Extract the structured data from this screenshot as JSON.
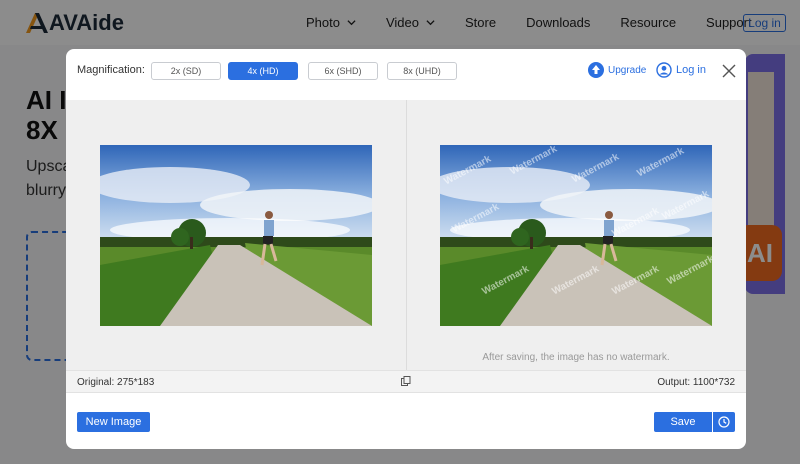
{
  "brand": {
    "name": "AVAide"
  },
  "nav": {
    "items": [
      {
        "label": "Photo",
        "dropdown": true
      },
      {
        "label": "Video",
        "dropdown": true
      },
      {
        "label": "Store",
        "dropdown": false
      },
      {
        "label": "Downloads",
        "dropdown": false
      },
      {
        "label": "Resource",
        "dropdown": false
      },
      {
        "label": "Support",
        "dropdown": false
      }
    ],
    "login_label": "Log in"
  },
  "background": {
    "title_line1": "AI I",
    "title_line2": "8X",
    "subtitle_line1": "Upsca",
    "subtitle_line2": "blurry",
    "badge_text": "AI"
  },
  "modal": {
    "magnification_label": "Magnification:",
    "magnification_options": [
      {
        "label": "2x (SD)",
        "active": false
      },
      {
        "label": "4x (HD)",
        "active": true
      },
      {
        "label": "6x (SHD)",
        "active": false
      },
      {
        "label": "8x (UHD)",
        "active": false
      }
    ],
    "upgrade_label": "Upgrade",
    "login_label": "Log in",
    "watermark_text": "Watermark",
    "watermark_note": "After saving, the image has no watermark.",
    "original_info": "Original: 275*183",
    "output_info": "Output: 1100*732",
    "new_image_label": "New Image",
    "save_label": "Save"
  },
  "colors": {
    "accent": "#2b6fe0",
    "overlay": "rgba(0,0,0,0.45)",
    "logo_orange": "#f39a1e"
  },
  "icons": {
    "upgrade": "arrow-up-circle-icon",
    "login": "user-circle-icon",
    "close": "close-icon",
    "copy": "copy-icon",
    "history": "clock-icon"
  }
}
